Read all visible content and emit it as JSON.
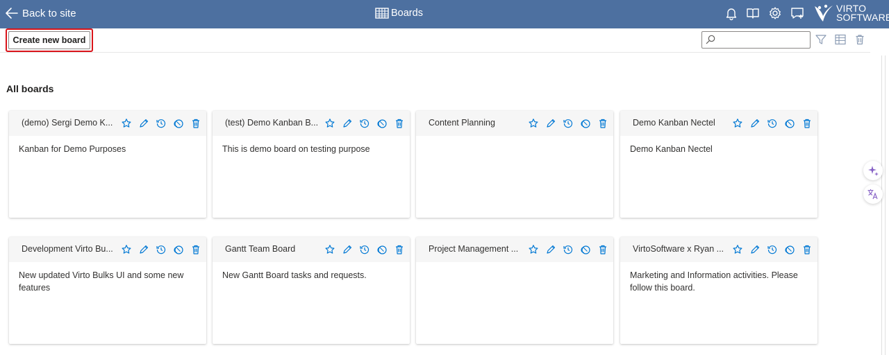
{
  "header": {
    "back_label": "Back to site",
    "title": "Boards",
    "icons": [
      "bell-icon",
      "book-icon",
      "gear-icon",
      "chat-add-icon"
    ],
    "logo_line1": "VIRTO",
    "logo_line2": "SOFTWARE"
  },
  "toolbar": {
    "create_label": "Create new board",
    "search_value": "",
    "search_placeholder": "",
    "icons": [
      "filter-icon",
      "table-view-icon",
      "delete-icon"
    ]
  },
  "section_title": "All boards",
  "card_actions": [
    "star-icon",
    "edit-icon",
    "history-icon",
    "copy-icon",
    "delete-icon"
  ],
  "boards": [
    {
      "title": "(demo) Sergi Demo K...",
      "description": "Kanban for Demo Purposes"
    },
    {
      "title": "(test) Demo Kanban B...",
      "description": "This is demo board on testing purpose"
    },
    {
      "title": "Content Planning",
      "description": ""
    },
    {
      "title": "Demo Kanban Nectel",
      "description": "Demo Kanban Nectel"
    },
    {
      "title": "Development Virto Bu...",
      "description": "New updated Virto Bulks UI and some new features"
    },
    {
      "title": "Gantt Team Board",
      "description": "New Gantt Board tasks and requests."
    },
    {
      "title": "Project Management ...",
      "description": ""
    },
    {
      "title": "VirtoSoftware x Ryan ...",
      "description": "Marketing and Information activities. Please follow this board."
    }
  ],
  "colors": {
    "header_bg": "#4d70a0",
    "accent": "#0078d4",
    "highlight": "#d9141a",
    "copilot": "#8661c5"
  }
}
